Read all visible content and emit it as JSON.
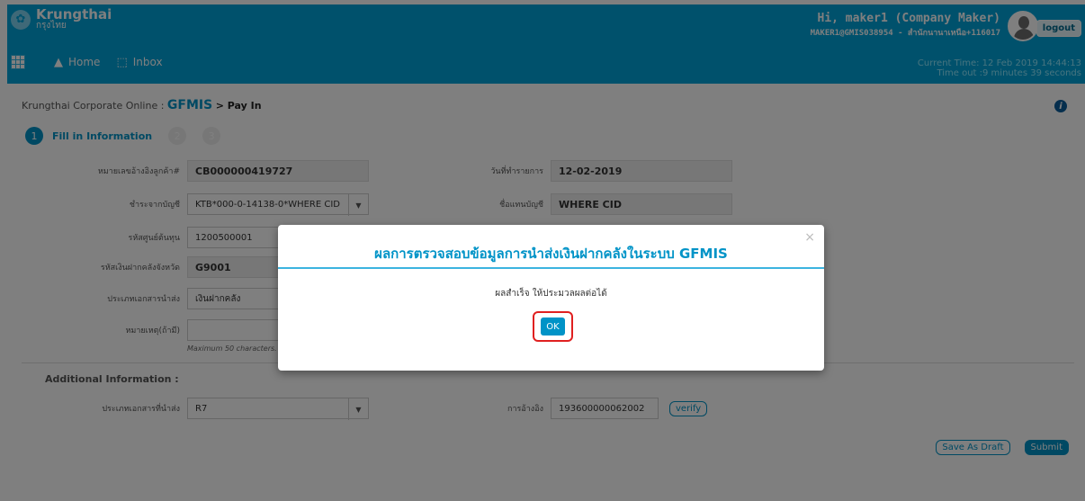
{
  "header": {
    "brand_name": "Krungthai",
    "brand_sub": "กรุงไทย",
    "greeting": "Hi, maker1 (Company Maker)",
    "user_id": "MAKER1@GMIS038954 - สำนักนานาเหนือ+116017",
    "logout_label": "logout",
    "nav": {
      "home_label": "Home",
      "inbox_label": "Inbox"
    },
    "current_time": "Current Time: 12 Feb 2019 14:44:13",
    "timeout": "Time out :9 minutes 39 seconds"
  },
  "breadcrumb": {
    "root": "Krungthai Corporate Online :",
    "section": "GFMIS",
    "leaf": "> Pay In"
  },
  "steps": [
    {
      "number": "1",
      "label": "Fill in Information"
    },
    {
      "number": "2"
    },
    {
      "number": "3"
    }
  ],
  "form": {
    "customer_ref_label": "หมายเลขอ้างอิงลูกค้า#",
    "customer_ref_value": "CB000000419727",
    "trans_date_label": "วันที่ทำรายการ",
    "trans_date_value": "12-02-2019",
    "account_label": "ชำระจากบัญชี",
    "account_value": "KTB*000-0-14138-0*WHERE CID",
    "account_name_label": "ชื่อแทนบัญชี",
    "account_name_value": "WHERE CID",
    "cost_center_label": "รหัสศูนย์ต้นทุน",
    "cost_center_value": "1200500001",
    "deposit_code_label": "รหัสเงินฝากคลังจังหวัด",
    "deposit_code_value": "G9001",
    "doc_type_label": "ประเภทเอกสารนำส่ง",
    "doc_type_value": "เงินฝากคลัง",
    "remark_label": "หมายเหตุ(ถ้ามี)",
    "remark_value": "",
    "remark_hint": "Maximum 50 characters."
  },
  "additional": {
    "title": "Additional Information :",
    "doc_type_label": "ประเภทเอกสารที่นำส่ง",
    "doc_type_value": "R7",
    "ref_label": "การอ้างอิง",
    "ref_value": "193600000062002",
    "verify_label": "verify"
  },
  "actions": {
    "save_draft_label": "Save As Draft",
    "submit_label": "Submit"
  },
  "modal": {
    "title": "ผลการตรวจสอบข้อมูลการนำส่งเงินฝากคลังในระบบ GFMIS",
    "message": "ผลสำเร็จ ให้ประมวลผลต่อได้",
    "ok_label": "OK",
    "close_glyph": "×"
  },
  "colors": {
    "brand": "#00a2d9",
    "accent": "#0093c7",
    "highlight": "#e02020"
  }
}
